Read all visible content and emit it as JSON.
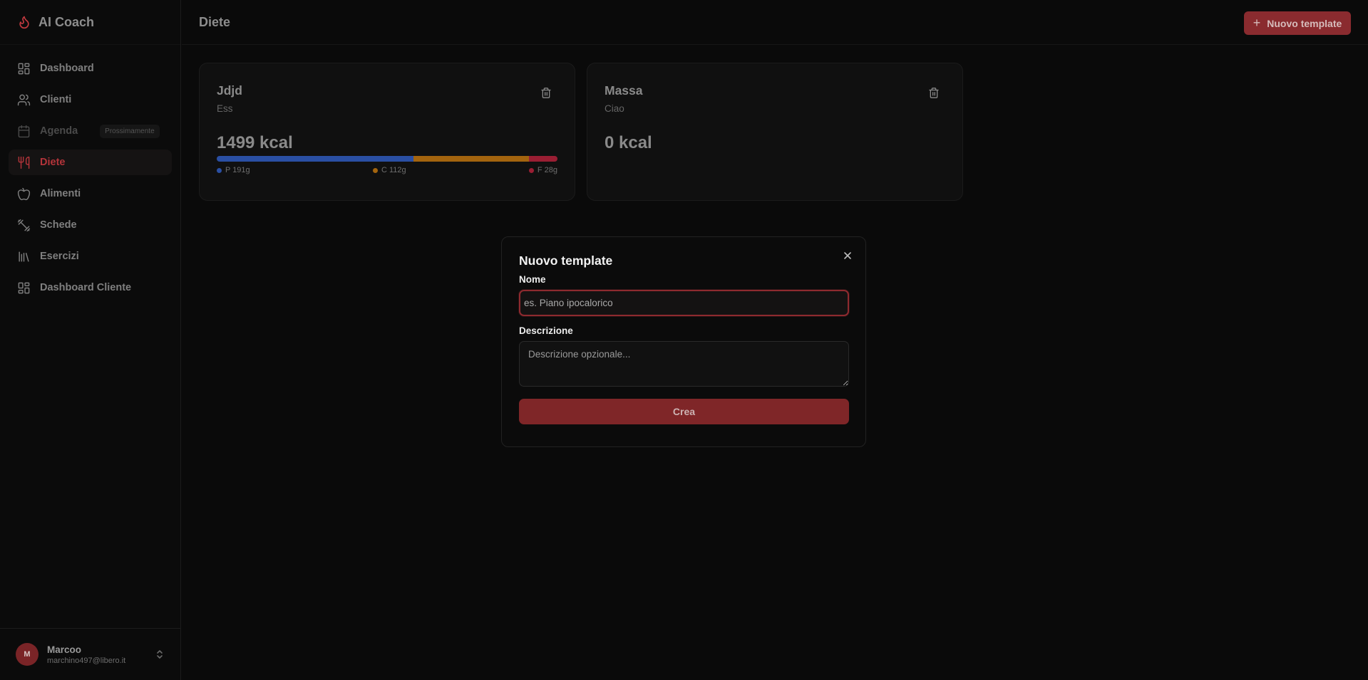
{
  "app": {
    "name": "AI Coach"
  },
  "sidebar": {
    "items": [
      {
        "label": "Dashboard",
        "icon": "dashboard-icon"
      },
      {
        "label": "Clienti",
        "icon": "users-icon"
      },
      {
        "label": "Agenda",
        "icon": "calendar-icon",
        "badge": "Prossimamente",
        "disabled": true
      },
      {
        "label": "Diete",
        "icon": "utensils-icon",
        "active": true
      },
      {
        "label": "Alimenti",
        "icon": "apple-icon"
      },
      {
        "label": "Schede",
        "icon": "dumbbell-icon"
      },
      {
        "label": "Esercizi",
        "icon": "library-icon"
      },
      {
        "label": "Dashboard Cliente",
        "icon": "dashboard-icon"
      }
    ]
  },
  "user": {
    "initial": "M",
    "name": "Marcoo",
    "email": "marchino497@libero.it"
  },
  "header": {
    "title": "Diete",
    "new_button_label": "Nuovo template"
  },
  "templates": [
    {
      "title": "Jdjd",
      "description": "Ess",
      "kcal": "1499 kcal",
      "macros": [
        {
          "label": "P 191g",
          "grams": 191,
          "color": "#2a4fa3"
        },
        {
          "label": "C 112g",
          "grams": 112,
          "color": "#a3640e"
        },
        {
          "label": "F 28g",
          "grams": 28,
          "color": "#9a1e33"
        }
      ]
    },
    {
      "title": "Massa",
      "description": "Ciao",
      "kcal": "0 kcal",
      "macros": []
    }
  ],
  "modal": {
    "title": "Nuovo template",
    "name_label": "Nome",
    "name_placeholder": "es. Piano ipocalorico",
    "name_value": "",
    "description_label": "Descrizione",
    "description_placeholder": "Descrizione opzionale...",
    "description_value": "",
    "submit_label": "Crea"
  },
  "colors": {
    "accent": "#8a2b2f",
    "active_text": "#b4343a",
    "background": "#0a0a0a"
  }
}
